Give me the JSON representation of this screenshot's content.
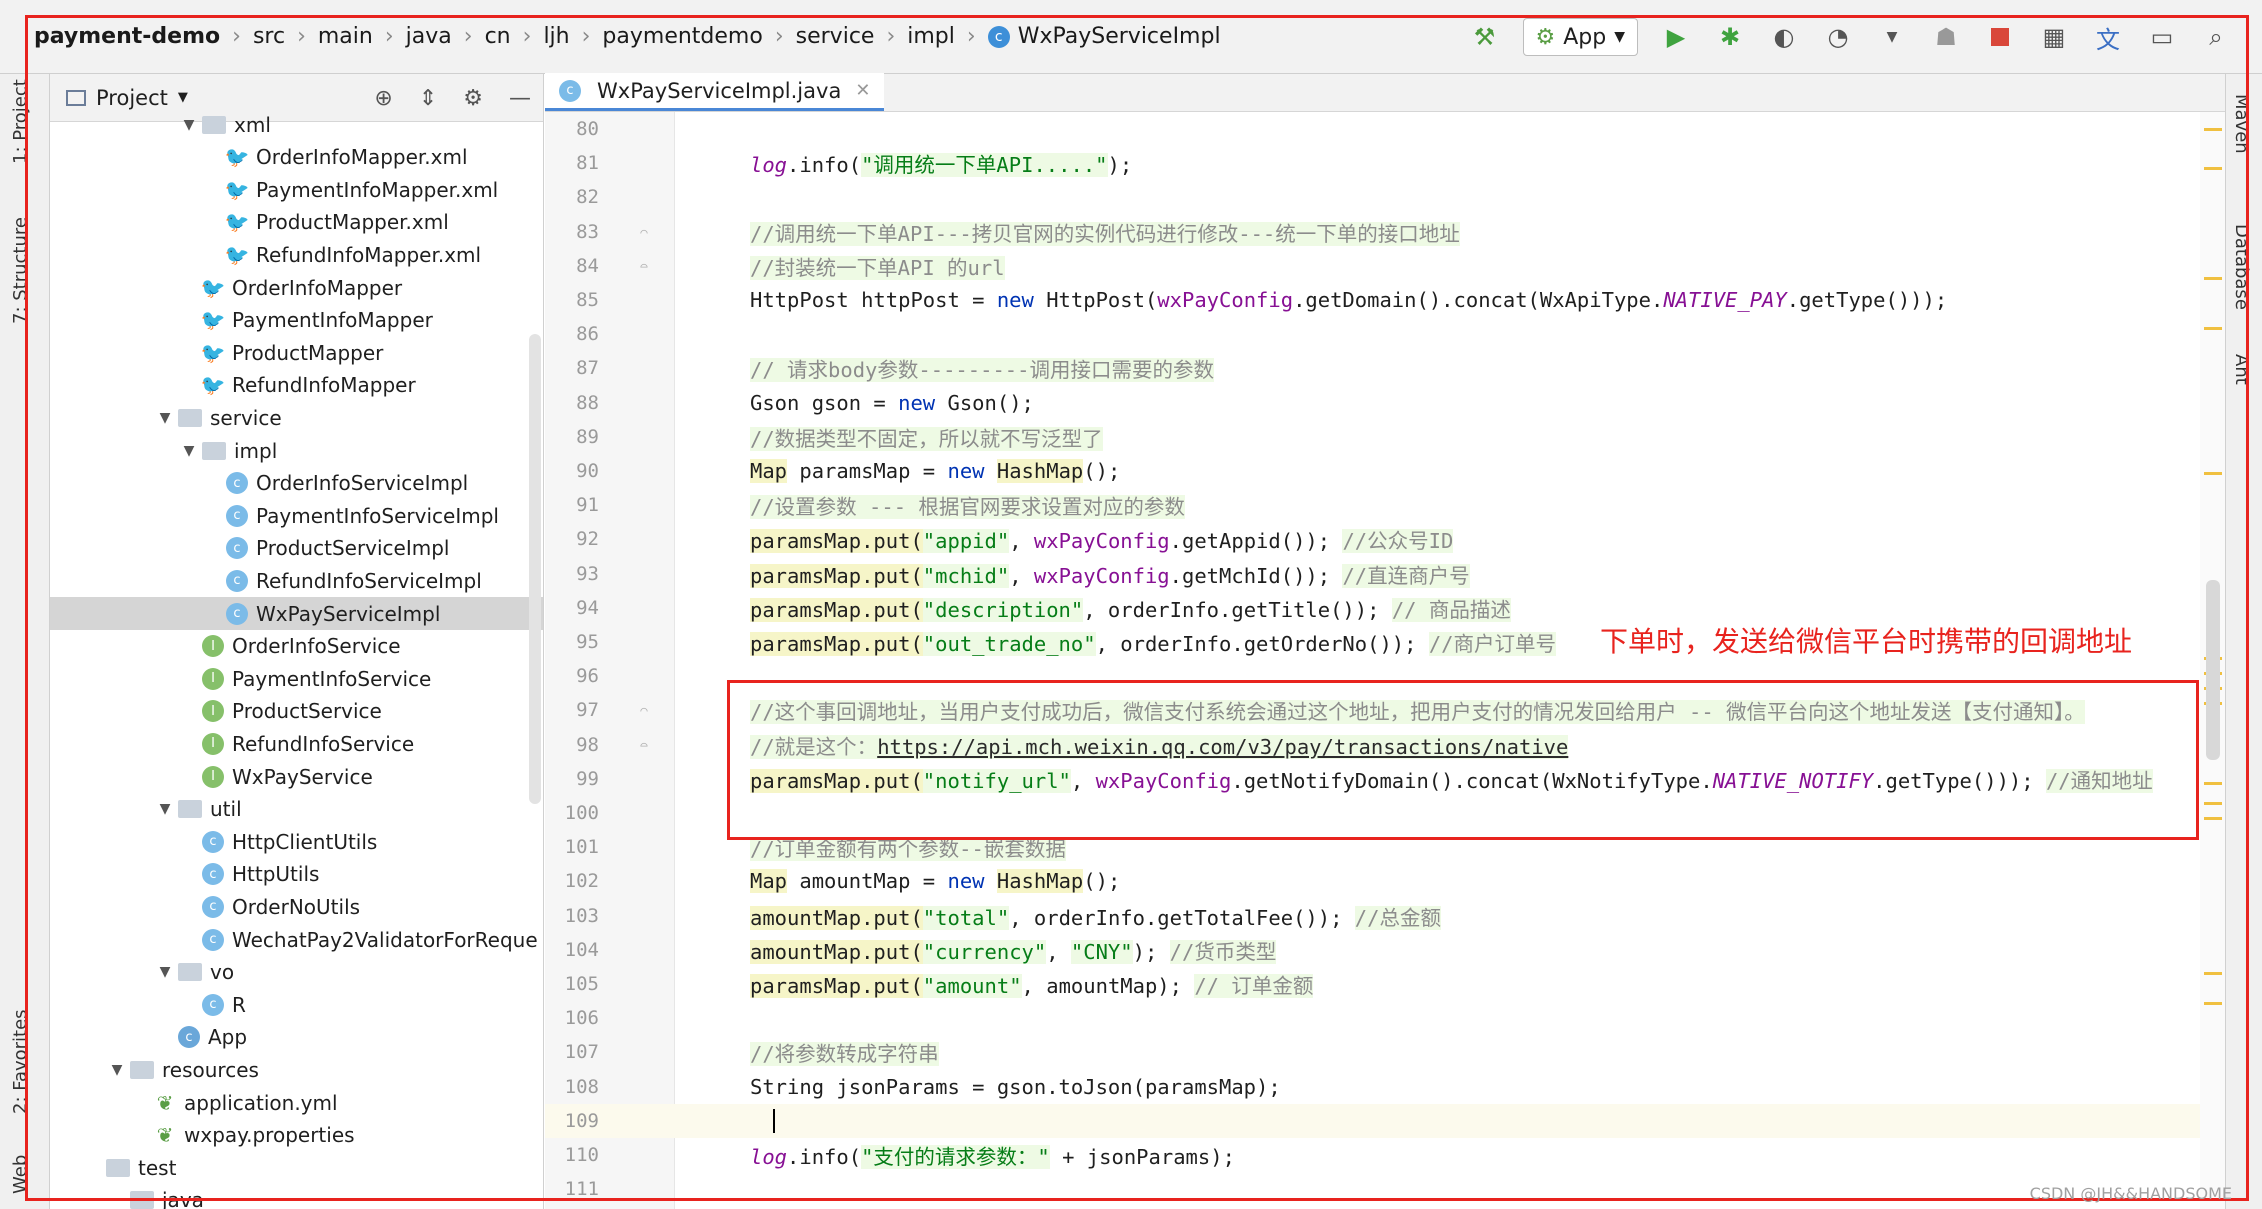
{
  "navbar": {
    "breadcrumb": [
      "payment-demo",
      "src",
      "main",
      "java",
      "cn",
      "ljh",
      "paymentdemo",
      "service",
      "impl",
      "WxPayServiceImpl"
    ],
    "run_config_label": "App"
  },
  "left_strip": {
    "tabs": [
      "1: Project",
      "7: Structure",
      "2: Favorites",
      "Web"
    ]
  },
  "project_panel": {
    "title": "Project",
    "tree": [
      {
        "label": "xml",
        "type": "folder",
        "depth": 3,
        "arrow": "▼"
      },
      {
        "label": "OrderInfoMapper.xml",
        "type": "mybatis",
        "depth": 4
      },
      {
        "label": "PaymentInfoMapper.xml",
        "type": "mybatis",
        "depth": 4
      },
      {
        "label": "ProductMapper.xml",
        "type": "mybatis",
        "depth": 4
      },
      {
        "label": "RefundInfoMapper.xml",
        "type": "mybatis",
        "depth": 4
      },
      {
        "label": "OrderInfoMapper",
        "type": "mybatis",
        "depth": 3
      },
      {
        "label": "PaymentInfoMapper",
        "type": "mybatis",
        "depth": 3
      },
      {
        "label": "ProductMapper",
        "type": "mybatis",
        "depth": 3
      },
      {
        "label": "RefundInfoMapper",
        "type": "mybatis",
        "depth": 3
      },
      {
        "label": "service",
        "type": "folder",
        "depth": 2,
        "arrow": "▼"
      },
      {
        "label": "impl",
        "type": "folder",
        "depth": 3,
        "arrow": "▼"
      },
      {
        "label": "OrderInfoServiceImpl",
        "type": "class",
        "depth": 4
      },
      {
        "label": "PaymentInfoServiceImpl",
        "type": "class",
        "depth": 4
      },
      {
        "label": "ProductServiceImpl",
        "type": "class",
        "depth": 4
      },
      {
        "label": "RefundInfoServiceImpl",
        "type": "class",
        "depth": 4
      },
      {
        "label": "WxPayServiceImpl",
        "type": "class",
        "depth": 4,
        "selected": true
      },
      {
        "label": "OrderInfoService",
        "type": "interface",
        "depth": 3
      },
      {
        "label": "PaymentInfoService",
        "type": "interface",
        "depth": 3
      },
      {
        "label": "ProductService",
        "type": "interface",
        "depth": 3
      },
      {
        "label": "RefundInfoService",
        "type": "interface",
        "depth": 3
      },
      {
        "label": "WxPayService",
        "type": "interface",
        "depth": 3
      },
      {
        "label": "util",
        "type": "folder",
        "depth": 2,
        "arrow": "▼"
      },
      {
        "label": "HttpClientUtils",
        "type": "class",
        "depth": 3
      },
      {
        "label": "HttpUtils",
        "type": "class",
        "depth": 3
      },
      {
        "label": "OrderNoUtils",
        "type": "class",
        "depth": 3
      },
      {
        "label": "WechatPay2ValidatorForReque",
        "type": "class",
        "depth": 3
      },
      {
        "label": "vo",
        "type": "folder",
        "depth": 2,
        "arrow": "▼"
      },
      {
        "label": "R",
        "type": "class",
        "depth": 3
      },
      {
        "label": "App",
        "type": "app",
        "depth": 2
      },
      {
        "label": "resources",
        "type": "folder",
        "depth": 0,
        "arrow": "▼"
      },
      {
        "label": "application.yml",
        "type": "yml",
        "depth": 1
      },
      {
        "label": "wxpay.properties",
        "type": "yml",
        "depth": 1
      },
      {
        "label": "test",
        "type": "folder",
        "depth": -1,
        "arrow": ""
      },
      {
        "label": "java",
        "type": "folder",
        "depth": 0,
        "arrow": ""
      }
    ]
  },
  "editor": {
    "tab_label": "WxPayServiceImpl.java",
    "current_line": "109",
    "lines": [
      {
        "n": "80",
        "tokens": []
      },
      {
        "n": "81",
        "tokens": [
          {
            "c": "lg",
            "t": "log"
          },
          {
            "c": "",
            "t": ".info("
          },
          {
            "c": "str",
            "t": "\"调用统一下单API.....\""
          },
          {
            "c": "",
            "t": ");"
          }
        ]
      },
      {
        "n": "82",
        "tokens": []
      },
      {
        "n": "83",
        "tokens": [
          {
            "c": "cm",
            "t": "//调用统一下单API---拷贝官网的实例代码进行修改---统一下单的接口地址"
          }
        ]
      },
      {
        "n": "84",
        "tokens": [
          {
            "c": "cm",
            "t": "//封装统一下单API 的url"
          }
        ]
      },
      {
        "n": "85",
        "tokens": [
          {
            "c": "",
            "t": "HttpPost httpPost = "
          },
          {
            "c": "kw",
            "t": "new"
          },
          {
            "c": "",
            "t": " HttpPost("
          },
          {
            "c": "fld",
            "t": "wxPayConfig"
          },
          {
            "c": "",
            "t": ".getDomain().concat(WxApiType."
          },
          {
            "c": "cst",
            "t": "NATIVE_PAY"
          },
          {
            "c": "",
            "t": ".getType()));"
          }
        ]
      },
      {
        "n": "86",
        "tokens": []
      },
      {
        "n": "87",
        "tokens": [
          {
            "c": "cm",
            "t": "// 请求body参数---------调用接口需要的参数"
          }
        ]
      },
      {
        "n": "88",
        "tokens": [
          {
            "c": "",
            "t": "Gson gson = "
          },
          {
            "c": "kw",
            "t": "new"
          },
          {
            "c": "",
            "t": " Gson();"
          }
        ]
      },
      {
        "n": "89",
        "tokens": [
          {
            "c": "cm",
            "t": "//数据类型不固定，所以就不写泛型了"
          }
        ]
      },
      {
        "n": "90",
        "tokens": [
          {
            "c": "hl",
            "t": "Map"
          },
          {
            "c": "",
            "t": " paramsMap = "
          },
          {
            "c": "kw",
            "t": "new"
          },
          {
            "c": "",
            "t": " "
          },
          {
            "c": "hl",
            "t": "HashMap"
          },
          {
            "c": "",
            "t": "();"
          }
        ]
      },
      {
        "n": "91",
        "tokens": [
          {
            "c": "cm",
            "t": "//设置参数 --- 根据官网要求设置对应的参数"
          }
        ]
      },
      {
        "n": "92",
        "tokens": [
          {
            "c": "hl",
            "t": "paramsMap.put("
          },
          {
            "c": "str",
            "t": "\"appid\""
          },
          {
            "c": "",
            "t": ", "
          },
          {
            "c": "fld",
            "t": "wxPayConfig"
          },
          {
            "c": "",
            "t": ".getAppid()); "
          },
          {
            "c": "cm",
            "t": "//公众号ID"
          }
        ]
      },
      {
        "n": "93",
        "tokens": [
          {
            "c": "hl",
            "t": "paramsMap.put("
          },
          {
            "c": "str",
            "t": "\"mchid\""
          },
          {
            "c": "",
            "t": ", "
          },
          {
            "c": "fld",
            "t": "wxPayConfig"
          },
          {
            "c": "",
            "t": ".getMchId()); "
          },
          {
            "c": "cm",
            "t": "//直连商户号"
          }
        ]
      },
      {
        "n": "94",
        "tokens": [
          {
            "c": "hl",
            "t": "paramsMap.put("
          },
          {
            "c": "str",
            "t": "\"description\""
          },
          {
            "c": "",
            "t": ", orderInfo.getTitle()); "
          },
          {
            "c": "cm",
            "t": "// 商品描述"
          }
        ]
      },
      {
        "n": "95",
        "tokens": [
          {
            "c": "hl",
            "t": "paramsMap.put("
          },
          {
            "c": "str",
            "t": "\"out_trade_no\""
          },
          {
            "c": "",
            "t": ", orderInfo.getOrderNo()); "
          },
          {
            "c": "cm",
            "t": "//商户订单号"
          }
        ]
      },
      {
        "n": "96",
        "tokens": []
      },
      {
        "n": "97",
        "tokens": [
          {
            "c": "cm",
            "t": "//这个事回调地址，当用户支付成功后，微信支付系统会通过这个地址，把用户支付的情况发回给用户 -- 微信平台向这个地址发送【支付通知】。"
          }
        ]
      },
      {
        "n": "98",
        "tokens": [
          {
            "c": "cm",
            "t": "//就是这个："
          },
          {
            "c": "lnk",
            "t": "https://api.mch.weixin.qq.com/v3/pay/transactions/native"
          }
        ]
      },
      {
        "n": "99",
        "tokens": [
          {
            "c": "hl",
            "t": "paramsMap.put("
          },
          {
            "c": "str",
            "t": "\"notify_url\""
          },
          {
            "c": "",
            "t": ", "
          },
          {
            "c": "fld",
            "t": "wxPayConfig"
          },
          {
            "c": "",
            "t": ".getNotifyDomain().concat(WxNotifyType."
          },
          {
            "c": "cst",
            "t": "NATIVE_NOTIFY"
          },
          {
            "c": "",
            "t": ".getType())); "
          },
          {
            "c": "cm",
            "t": "//通知地址"
          }
        ]
      },
      {
        "n": "100",
        "tokens": []
      },
      {
        "n": "101",
        "tokens": [
          {
            "c": "cm",
            "t": "//订单金额有两个参数--嵌套数据"
          }
        ]
      },
      {
        "n": "102",
        "tokens": [
          {
            "c": "hl",
            "t": "Map"
          },
          {
            "c": "",
            "t": " amountMap = "
          },
          {
            "c": "kw",
            "t": "new"
          },
          {
            "c": "",
            "t": " "
          },
          {
            "c": "hl",
            "t": "HashMap"
          },
          {
            "c": "",
            "t": "();"
          }
        ]
      },
      {
        "n": "103",
        "tokens": [
          {
            "c": "hl",
            "t": "amountMap.put("
          },
          {
            "c": "str",
            "t": "\"total\""
          },
          {
            "c": "",
            "t": ", orderInfo.getTotalFee()); "
          },
          {
            "c": "cm",
            "t": "//总金额"
          }
        ]
      },
      {
        "n": "104",
        "tokens": [
          {
            "c": "hl",
            "t": "amountMap.put("
          },
          {
            "c": "str",
            "t": "\"currency\""
          },
          {
            "c": "",
            "t": ", "
          },
          {
            "c": "str",
            "t": "\"CNY\""
          },
          {
            "c": "",
            "t": "); "
          },
          {
            "c": "cm",
            "t": "//货币类型"
          }
        ]
      },
      {
        "n": "105",
        "tokens": [
          {
            "c": "hl",
            "t": "paramsMap.put("
          },
          {
            "c": "str",
            "t": "\"amount\""
          },
          {
            "c": "",
            "t": ", amountMap); "
          },
          {
            "c": "cm",
            "t": "// 订单金额"
          }
        ]
      },
      {
        "n": "106",
        "tokens": []
      },
      {
        "n": "107",
        "tokens": [
          {
            "c": "cm",
            "t": "//将参数转成字符串"
          }
        ]
      },
      {
        "n": "108",
        "tokens": [
          {
            "c": "",
            "t": "String jsonParams = gson.toJson(paramsMap);"
          }
        ]
      },
      {
        "n": "109",
        "tokens": []
      },
      {
        "n": "110",
        "tokens": [
          {
            "c": "lg",
            "t": "log"
          },
          {
            "c": "",
            "t": ".info("
          },
          {
            "c": "str",
            "t": "\"支付的请求参数：\""
          },
          {
            "c": "",
            "t": " + jsonParams);"
          }
        ]
      },
      {
        "n": "111",
        "tokens": []
      }
    ]
  },
  "annotation": {
    "text": "下单时，发送给微信平台时携带的回调地址"
  },
  "right_strip": {
    "tabs": [
      "Maven",
      "Database",
      "Ant"
    ]
  },
  "watermark": "CSDN @JH&&HANDSOME",
  "colors": {
    "annotation": "#e8231e",
    "keyword": "#0033b3",
    "string": "#067d17",
    "field": "#871094",
    "comment": "#8c8c8c"
  }
}
